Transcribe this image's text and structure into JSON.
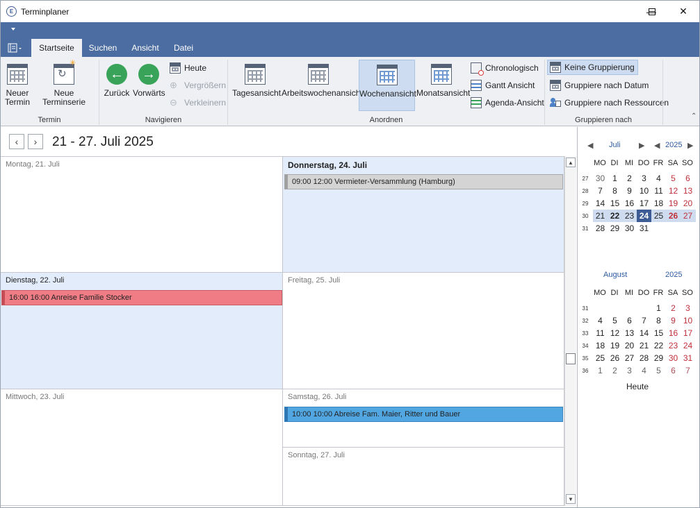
{
  "window": {
    "title": "Terminplaner"
  },
  "tabs": [
    "Startseite",
    "Suchen",
    "Ansicht",
    "Datei"
  ],
  "ribbon": {
    "termin": {
      "new_appt": "Neuer\nTermin",
      "new_series": "Neue Terminserie",
      "label": "Termin"
    },
    "navigieren": {
      "back": "Zurück",
      "forward": "Vorwärts",
      "today": "Heute",
      "zoom_in": "Vergrößern",
      "zoom_out": "Verkleinern",
      "label": "Navigieren"
    },
    "anordnen": {
      "day": "Tagesansicht",
      "workweek": "Arbeitswochenansicht",
      "week": "Wochenansicht",
      "month": "Monatsansicht",
      "timeline": "Chronologisch",
      "gantt": "Gantt Ansicht",
      "agenda": "Agenda-Ansicht",
      "label": "Anordnen"
    },
    "gruppieren": {
      "none": "Keine Gruppierung",
      "by_date": "Gruppiere nach Datum",
      "by_resource": "Gruppiere nach Ressourcen",
      "label": "Gruppieren nach"
    }
  },
  "calendar": {
    "range_title": "21 - 27. Juli 2025",
    "days": {
      "mon": "Montag, 21. Juli",
      "tue": "Dienstag, 22. Juli",
      "wed": "Mittwoch, 23. Juli",
      "thu": "Donnerstag, 24. Juli",
      "fri": "Freitag, 25. Juli",
      "sat": "Samstag, 26. Juli",
      "sun": "Sonntag, 27. Juli"
    },
    "appointments": {
      "thu": "09:00  12:00  Vermieter-Versammlung (Hamburg)",
      "tue": "16:00  16:00  Anreise Familie Stocker",
      "sat": "10:00  10:00  Abreise Fam. Maier, Ritter und Bauer"
    }
  },
  "mini_calendar": {
    "weekdays": [
      "MO",
      "DI",
      "MI",
      "DO",
      "FR",
      "SA",
      "SO"
    ],
    "july": {
      "month": "Juli",
      "year": "2025",
      "weeks": [
        "27",
        "28",
        "29",
        "30",
        "31"
      ],
      "days": [
        [
          "30",
          "1",
          "2",
          "3",
          "4",
          "5",
          "6"
        ],
        [
          "7",
          "8",
          "9",
          "10",
          "11",
          "12",
          "13"
        ],
        [
          "14",
          "15",
          "16",
          "17",
          "18",
          "19",
          "20"
        ],
        [
          "21",
          "22",
          "23",
          "24",
          "25",
          "26",
          "27"
        ],
        [
          "28",
          "29",
          "30",
          "31",
          "",
          "",
          ""
        ]
      ]
    },
    "august": {
      "month": "August",
      "year": "2025",
      "weeks": [
        "31",
        "32",
        "33",
        "34",
        "35",
        "36"
      ],
      "days": [
        [
          "",
          "",
          "",
          "",
          "1",
          "2",
          "3"
        ],
        [
          "4",
          "5",
          "6",
          "7",
          "8",
          "9",
          "10"
        ],
        [
          "11",
          "12",
          "13",
          "14",
          "15",
          "16",
          "17"
        ],
        [
          "18",
          "19",
          "20",
          "21",
          "22",
          "23",
          "24"
        ],
        [
          "25",
          "26",
          "27",
          "28",
          "29",
          "30",
          "31"
        ],
        [
          "1",
          "2",
          "3",
          "4",
          "5",
          "6",
          "7"
        ]
      ]
    },
    "today_label": "Heute"
  },
  "colors": {
    "accent": "#4c6da1",
    "selected": "#cddcf0",
    "today": "#3d5c96"
  }
}
